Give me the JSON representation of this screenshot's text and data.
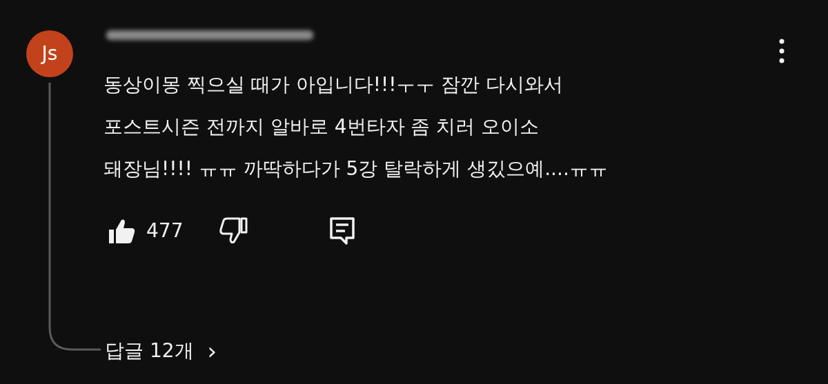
{
  "comment": {
    "avatar": {
      "initials": "Js",
      "color": "#c2421b"
    },
    "lines": [
      "동상이몽 찍으실 때가 아입니다!!!ㅜㅜ 잠깐 다시와서",
      "포스트시즌 전까지 알바로 4번타자 좀 치러 오이소",
      "돼장님!!!! ㅠㅠ 까딱하다가 5강 탈락하게 생깄으예....ㅠㅠ"
    ],
    "likes": "477",
    "liked": true,
    "disliked": false,
    "replies": "답글 12개",
    "reply_arrow": "›"
  }
}
